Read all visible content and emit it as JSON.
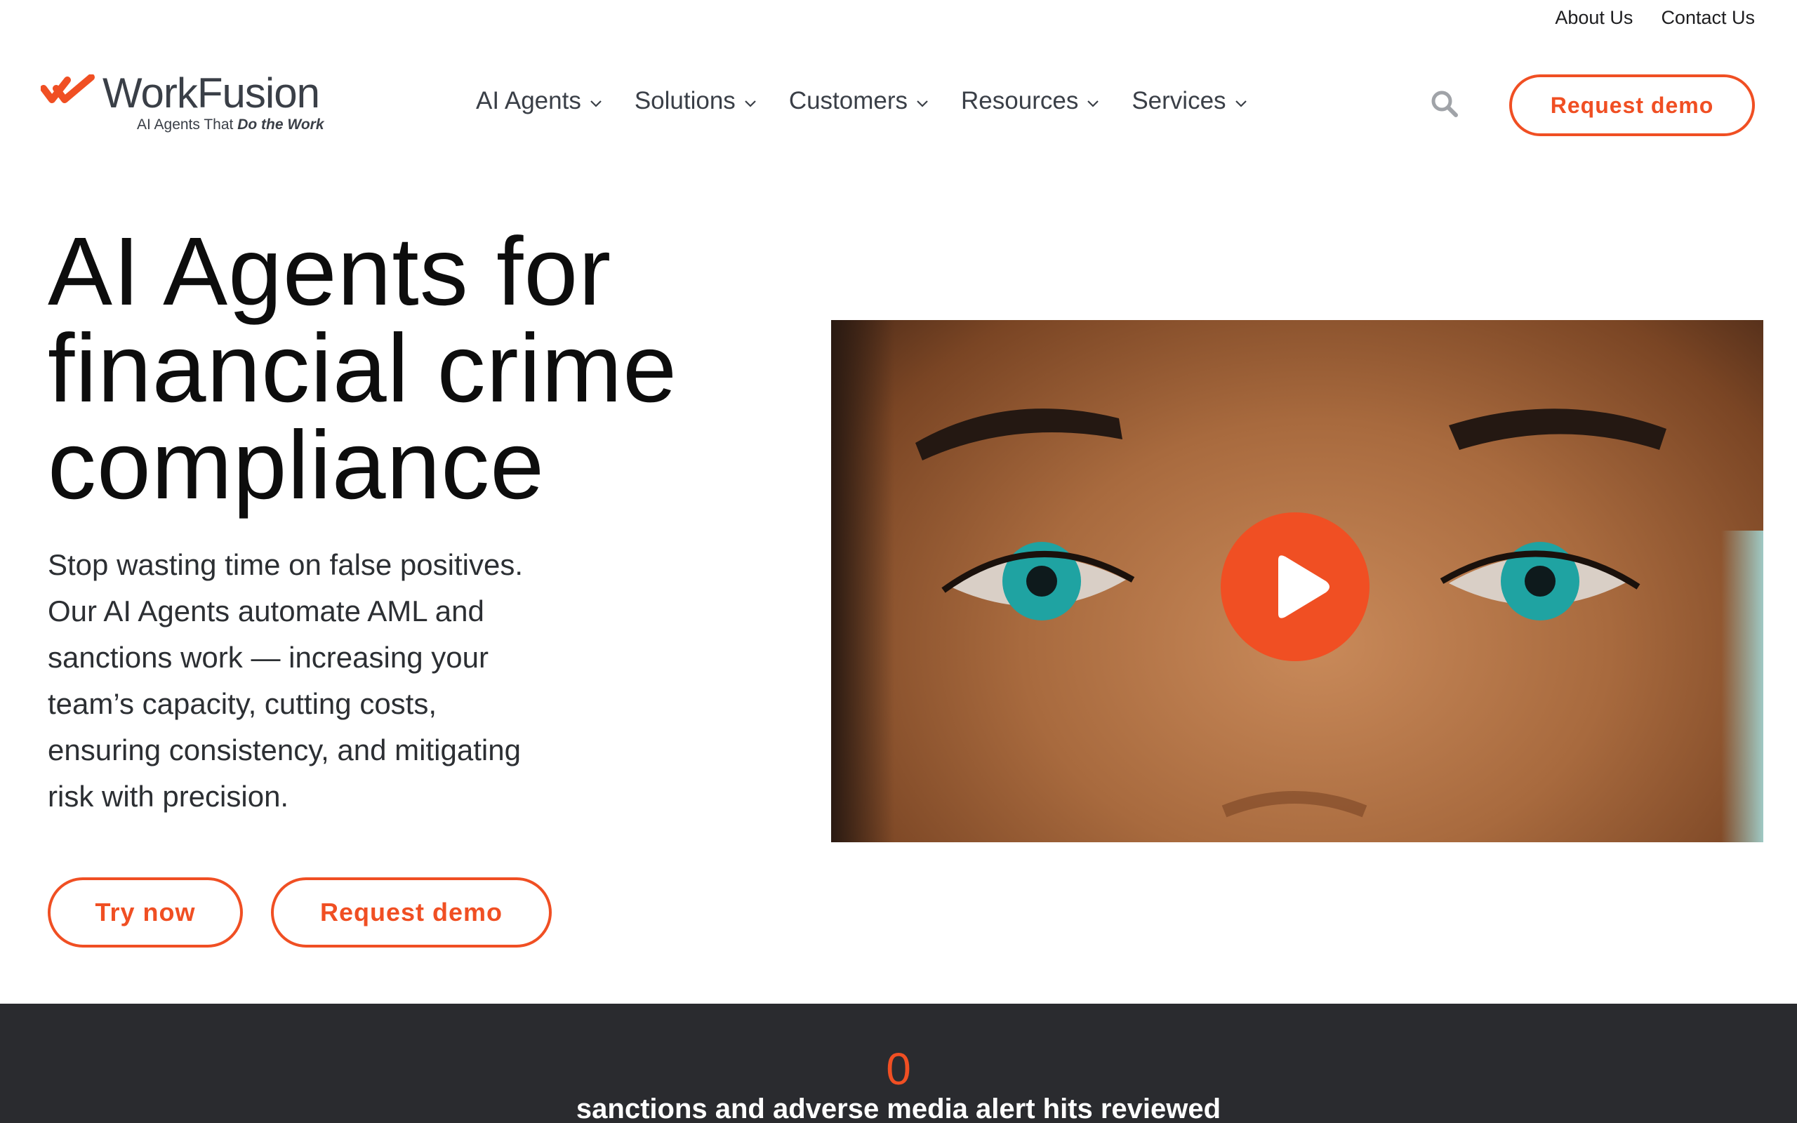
{
  "utility_nav": {
    "about": "About Us",
    "contact": "Contact Us"
  },
  "brand": {
    "name": "WorkFusion",
    "tagline_prefix": "AI Agents That ",
    "tagline_emphasis": "Do the Work",
    "accent_color": "#f04f23",
    "logo_icon": "double-check-icon"
  },
  "main_nav": {
    "items": [
      {
        "label": "AI Agents"
      },
      {
        "label": "Solutions"
      },
      {
        "label": "Customers"
      },
      {
        "label": "Resources"
      },
      {
        "label": "Services"
      }
    ]
  },
  "header": {
    "search_icon": "search-icon",
    "request_demo": "Request demo"
  },
  "hero": {
    "title_lines": [
      "AI Agents for",
      "financial crime",
      "compliance"
    ],
    "body_lines": [
      "Stop wasting time on false positives.",
      "Our AI Agents automate AML and",
      "sanctions work — increasing your",
      "team’s capacity, cutting costs,",
      "ensuring consistency, and mitigating",
      "risk with precision."
    ],
    "try_now": "Try now",
    "request_demo": "Request demo"
  },
  "video": {
    "play_icon": "play-icon"
  },
  "stats": {
    "value": "0",
    "label": "sanctions and adverse media alert hits reviewed"
  },
  "colors": {
    "accent": "#f04f23",
    "dark_band": "#2a2b2f",
    "text": "#111111"
  }
}
